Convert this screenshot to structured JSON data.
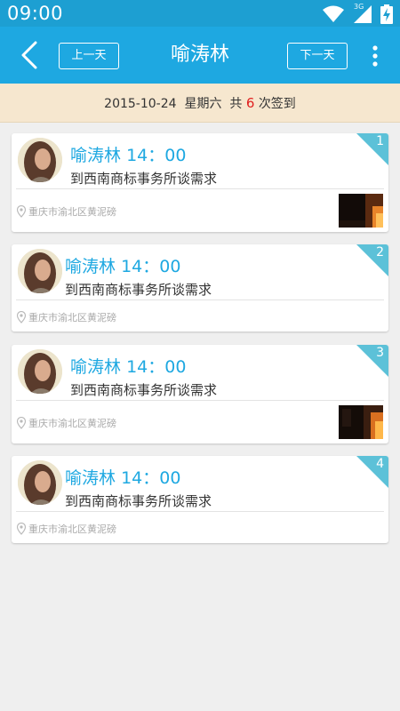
{
  "status_bar": {
    "time": "09:00",
    "network_label": "3G",
    "icons": [
      "wifi-icon",
      "cellular-signal-icon",
      "battery-charging-icon"
    ]
  },
  "header": {
    "title": "喻涛林",
    "prev_label": "上一天",
    "next_label": "下一天",
    "icons": [
      "back-arrow-icon",
      "more-vert-icon"
    ]
  },
  "summary": {
    "date": "2015-10-24",
    "weekday": "星期六",
    "prefix": "共",
    "count": "6",
    "suffix": "次签到"
  },
  "colors": {
    "primary": "#1ea8e1",
    "status_bar": "#1d9fd2",
    "summary_bg": "#f6e7cf",
    "count_red": "#e02020",
    "corner_badge": "#5cc1d8"
  },
  "checkins": [
    {
      "index": "1",
      "name": "喻涛林",
      "time": "14：00",
      "note": "到西南商标事务所谈需求",
      "location": "重庆市渝北区黄泥磅",
      "has_photo": true
    },
    {
      "index": "2",
      "name": "喻涛林",
      "time": "14：00",
      "note": "到西南商标事务所谈需求",
      "location": "重庆市渝北区黄泥磅",
      "has_photo": false
    },
    {
      "index": "3",
      "name": "喻涛林",
      "time": "14：00",
      "note": "到西南商标事务所谈需求",
      "location": "重庆市渝北区黄泥磅",
      "has_photo": true
    },
    {
      "index": "4",
      "name": "喻涛林",
      "time": "14：00",
      "note": "到西南商标事务所谈需求",
      "location": "重庆市渝北区黄泥磅",
      "has_photo": false
    }
  ]
}
